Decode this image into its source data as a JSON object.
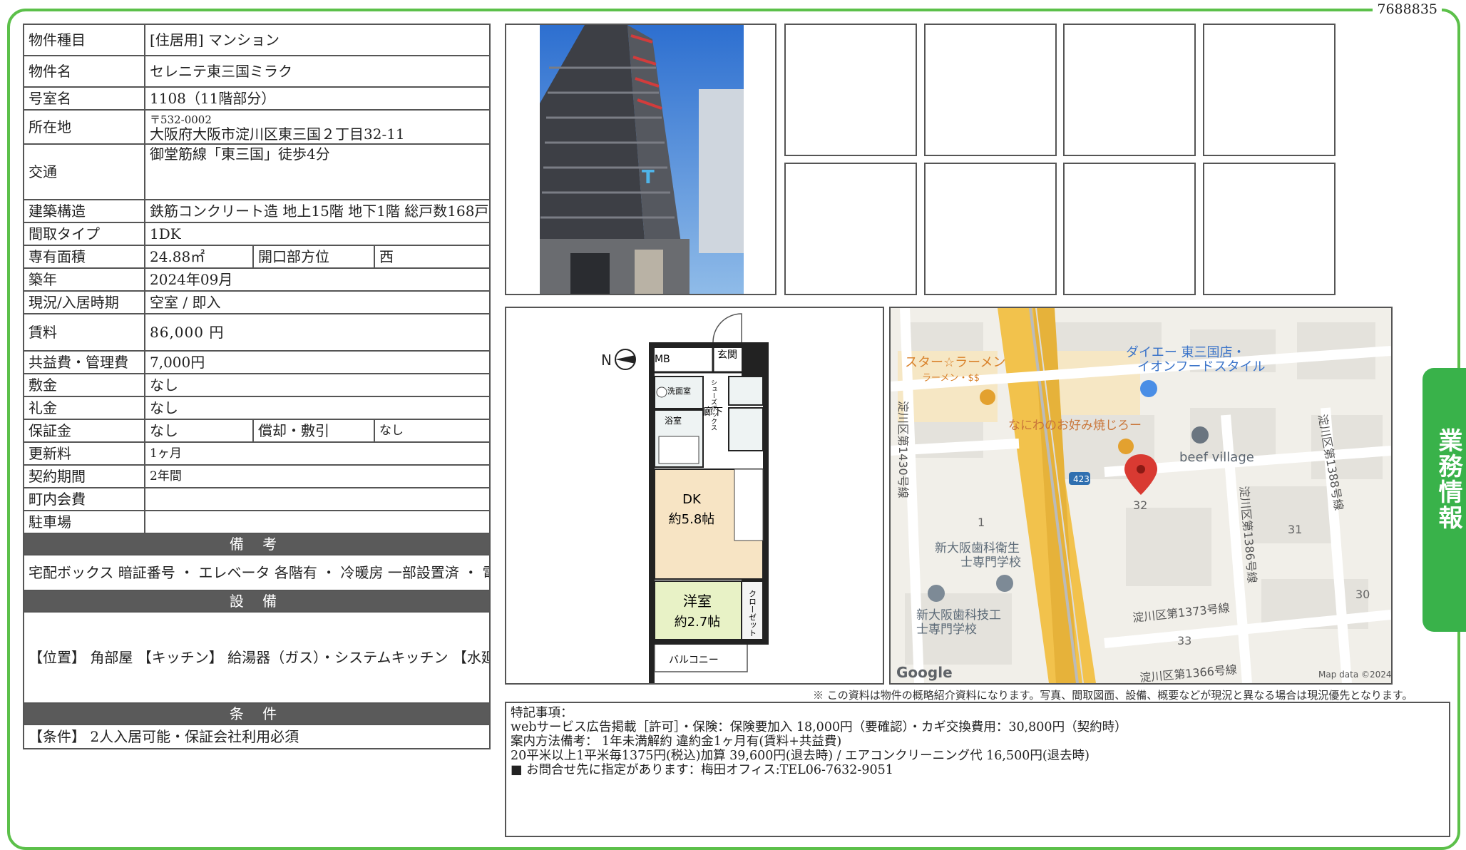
{
  "doc_number": "7688835",
  "side_tab": "業務情報",
  "property": {
    "type_label": "物件種目",
    "type_value": "[住居用] マンション",
    "name_label": "物件名",
    "name_value": "セレニテ東三国ミラク",
    "room_label": "号室名",
    "room_value": "1108（11階部分）",
    "address_label": "所在地",
    "postal": "〒532-0002",
    "address_value": "大阪府大阪市淀川区東三国２丁目32-11",
    "transport_label": "交通",
    "transport_value": "御堂筋線「東三国」徒歩4分",
    "structure_label": "建築構造",
    "structure_value": "鉄筋コンクリート造 地上15階 地下1階 総戸数168戸",
    "layout_label": "間取タイプ",
    "layout_value": "1DK",
    "area_label": "専有面積",
    "area_value": "24.88㎡",
    "direction_label": "開口部方位",
    "direction_value": "西",
    "built_label": "築年",
    "built_value": "2024年09月",
    "status_label": "現況/入居時期",
    "status_value": "空室 / 即入",
    "rent_label": "賃料",
    "rent_value": "86,000 円",
    "fee_label": "共益費・管理費",
    "fee_value": "7,000円",
    "deposit_label": "敷金",
    "deposit_value": "なし",
    "keymoney_label": "礼金",
    "keymoney_value": "なし",
    "guarantee_label": "保証金",
    "guarantee_value": "なし",
    "amort_label": "償却・敷引",
    "amort_value": "なし",
    "renewal_label": "更新料",
    "renewal_value": "1ヶ月",
    "contract_label": "契約期間",
    "contract_value": "2年間",
    "community_label": "町内会費",
    "community_value": "",
    "parking_label": "駐車場",
    "parking_value": ""
  },
  "sections": {
    "remarks_title": "備 考",
    "remarks_text": "宅配ボックス 暗証番号 ・ エレベータ 各階有 ・ 冷暖房 一部設置済 ・ 電気コンロ",
    "equipment_title": "設 備",
    "equipment_text": "【位置】 角部屋 【キッチン】 給湯器（ガス）・システムキッチン 【水廻り】 風呂・浴室乾燥機・シャワートイレ・バス・トイレ別・洗濯機置場（室内） 【冷暖房】 エアコン 【収納】 シューズボックス 【放送・通信】 ＣＳ・ネット使用料不要 【セキュリティ】 オートロック・宅配BOX・防犯カメラ・インターホン（カメラ付き） 【その他】 エレベーター・オートバイ駐輪場・自転車置場・バルコニー／ベランダ・フローリング",
    "conditions_title": "条 件",
    "conditions_text": "【条件】 2人入居可能・保証会社利用必須"
  },
  "floorplan": {
    "mb": "MB",
    "entrance": "玄関",
    "shoebox": "シューズボックス",
    "washroom": "洗面室",
    "hallway": "廊下",
    "bath": "浴室",
    "dk": "DK",
    "dk_size": "約5.8帖",
    "western": "洋室",
    "western_size": "約2.7帖",
    "closet": "クローゼット",
    "balcony": "バルコニー",
    "north": "N"
  },
  "map": {
    "label_star": "スター☆ラーメン",
    "label_star_sub": "ラーメン・$$",
    "label_daiei1": "ダイエー 東三国店・",
    "label_daiei2": "イオンフードスタイル",
    "label_okonomi": "なにわのお好み焼じろー",
    "label_beef": "beef village",
    "road_1430": "淀川区第1430号線",
    "road_1388": "淀川区第1388号線",
    "road_1386": "淀川区第1386号線",
    "road_1373": "淀川区第1373号線",
    "road_1366": "淀川区第1366号線",
    "route": "423",
    "school1a": "新大阪歯科衛生",
    "school1b": "士専門学校",
    "school2a": "新大阪歯科技工",
    "school2b": "士専門学校",
    "num_32": "32",
    "num_31": "31",
    "num_30": "30",
    "num_33": "33",
    "num_1": "1",
    "google": "Google",
    "mapdata": "Map data ©2024"
  },
  "disclaimer": "※ この資料は物件の概略紹介資料になります。写真、間取図面、設備、概要などが現況と異なる場合は現況優先となります。",
  "special": {
    "title": "特記事項：",
    "line1": "webサービス広告掲載［許可］・保険：保険要加入 18,000円（要確認）・カギ交換費用：30,800円（契約時）",
    "line2": "案内方法備考： 1年未満解約 違約金1ヶ月有(賃料+共益費)",
    "line3": "20平米以上1平米毎1375円(税込)加算 39,600円(退去時) / エアコンクリーニング代 16,500円(退去時)",
    "line4": "■ お問合せ先に指定があります：梅田オフィス:TEL06-7632-9051"
  }
}
